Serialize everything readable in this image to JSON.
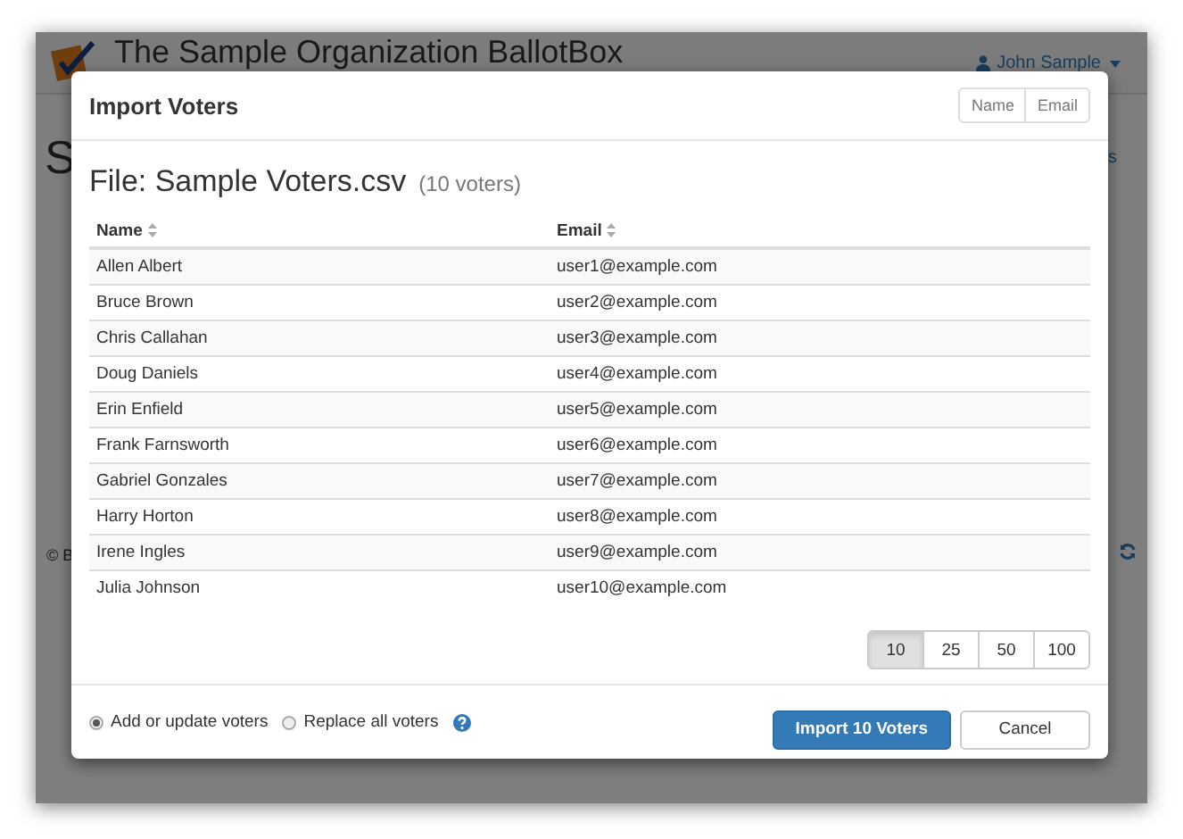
{
  "app_header": {
    "title": "The Sample Organization BallotBox",
    "user": "John Sample"
  },
  "background_fragments": {
    "heading": "S",
    "footer": "© B",
    "right_text": "s"
  },
  "dialog": {
    "title": "Import Voters",
    "column_toggles": [
      "Name",
      "Email"
    ],
    "file_heading": "File: Sample Voters.csv",
    "voter_count": "(10 voters)",
    "table": {
      "columns": [
        "Name",
        "Email"
      ],
      "rows": [
        {
          "name": "Allen Albert",
          "email": "user1@example.com"
        },
        {
          "name": "Bruce Brown",
          "email": "user2@example.com"
        },
        {
          "name": "Chris Callahan",
          "email": "user3@example.com"
        },
        {
          "name": "Doug Daniels",
          "email": "user4@example.com"
        },
        {
          "name": "Erin Enfield",
          "email": "user5@example.com"
        },
        {
          "name": "Frank Farnsworth",
          "email": "user6@example.com"
        },
        {
          "name": "Gabriel Gonzales",
          "email": "user7@example.com"
        },
        {
          "name": "Harry Horton",
          "email": "user8@example.com"
        },
        {
          "name": "Irene Ingles",
          "email": "user9@example.com"
        },
        {
          "name": "Julia Johnson",
          "email": "user10@example.com"
        }
      ]
    },
    "page_sizes": [
      {
        "label": "10",
        "selected": true
      },
      {
        "label": "25",
        "selected": false
      },
      {
        "label": "50",
        "selected": false
      },
      {
        "label": "100",
        "selected": false
      }
    ],
    "import_modes": [
      {
        "label": "Add or update voters",
        "selected": true
      },
      {
        "label": "Replace all voters",
        "selected": false
      }
    ],
    "buttons": [
      {
        "kind": "primary",
        "label": "Import 10 Voters"
      },
      {
        "kind": "default",
        "label": "Cancel"
      }
    ]
  }
}
